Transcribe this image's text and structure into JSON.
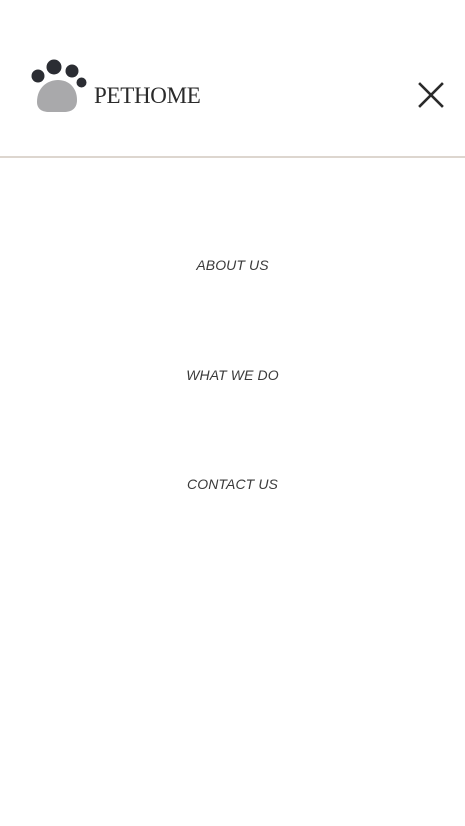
{
  "header": {
    "brand": "PETHOME",
    "logo_icon": "paw-icon",
    "close_icon": "close-icon"
  },
  "nav": {
    "items": [
      {
        "label": "ABOUT US"
      },
      {
        "label": "WHAT WE DO"
      },
      {
        "label": "CONTACT US"
      }
    ]
  },
  "colors": {
    "text": "#2a2a2a",
    "paw_pad": "#a9a9ab",
    "paw_toes": "#2b2d33",
    "divider": "#ddd6cf",
    "background": "#ffffff"
  }
}
